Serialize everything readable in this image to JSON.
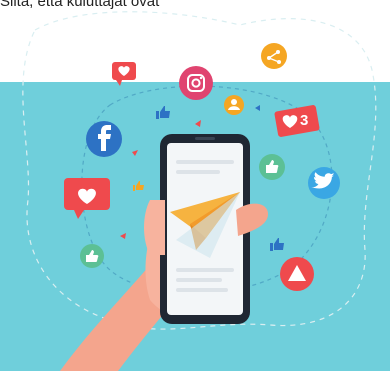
{
  "header": {
    "cropped_text": "Siitä, että kuluttajat ovat"
  },
  "illustration": {
    "badge_counter": "3",
    "icons": [
      "facebook-icon",
      "instagram-icon",
      "twitter-icon",
      "youtube-icon",
      "share-icon",
      "like-icon",
      "heart-icon",
      "paper-plane-icon",
      "user-icon"
    ],
    "colors": {
      "background": "#6fcfdb",
      "facebook": "#2d72c4",
      "instagram": "#e04470",
      "twitter": "#3aa7e4",
      "youtube": "#ef4a4d",
      "like": "#5cc095",
      "heart_badge": "#ef4a4d",
      "share": "#f5a623",
      "plane": "#f6b340"
    }
  }
}
